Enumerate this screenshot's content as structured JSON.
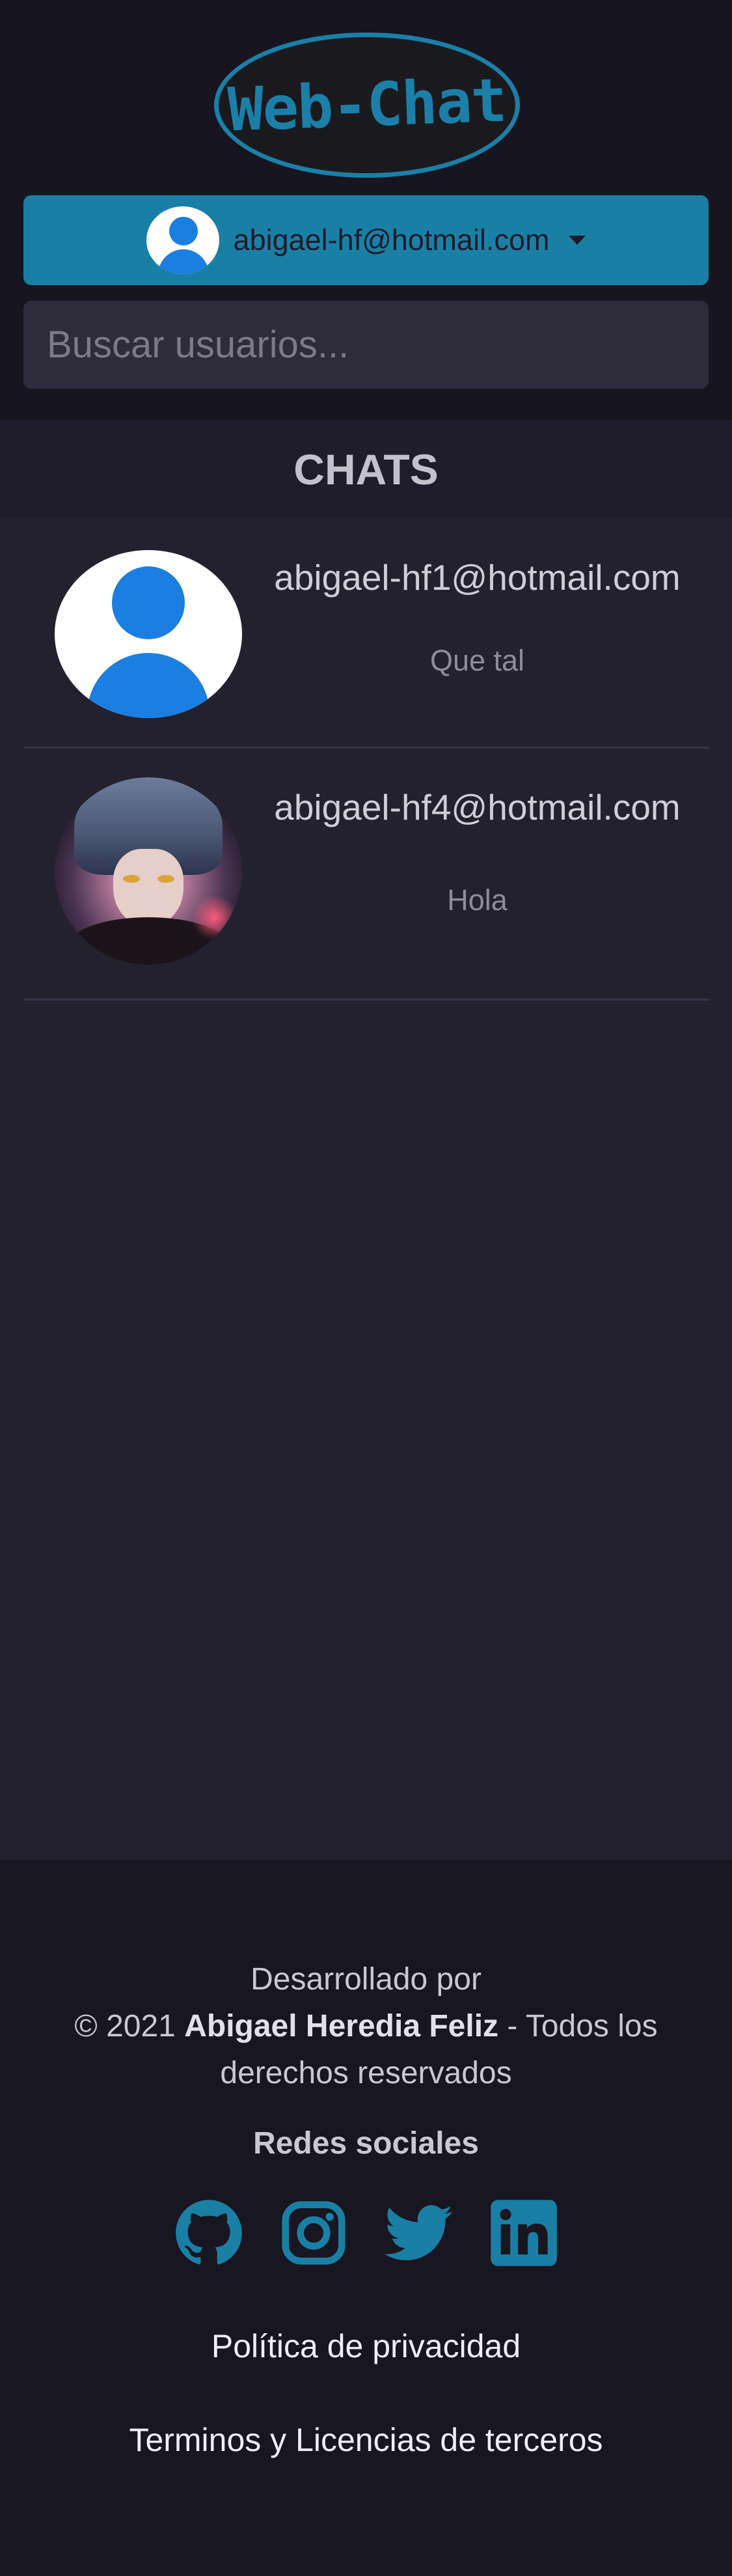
{
  "header": {
    "logo_text": "Web-Chat",
    "user_email": "abigael-hf@hotmail.com",
    "search_placeholder": "Buscar usuarios..."
  },
  "chats": {
    "title": "CHATS",
    "items": [
      {
        "email": "abigael-hf1@hotmail.com",
        "last_message": "Que tal",
        "avatar": "default-user-avatar"
      },
      {
        "email": "abigael-hf4@hotmail.com",
        "last_message": "Hola",
        "avatar": "anime-character-avatar"
      }
    ]
  },
  "footer": {
    "developed_by": "Desarrollado por",
    "copyright_prefix": "© 2021",
    "author": "Abigael Heredia Feliz",
    "rights": "- Todos los derechos reservados",
    "social_title": "Redes sociales",
    "social_icons": [
      "github-icon",
      "instagram-icon",
      "twitter-icon",
      "linkedin-icon"
    ],
    "privacy_link": "Política de privacidad",
    "terms_link": "Terminos y Licencias de terceros"
  },
  "colors": {
    "accent": "#1a7fa5",
    "header_bg": "#171520",
    "page_bg": "#24212f",
    "avatar_blue": "#1a7fe0"
  }
}
